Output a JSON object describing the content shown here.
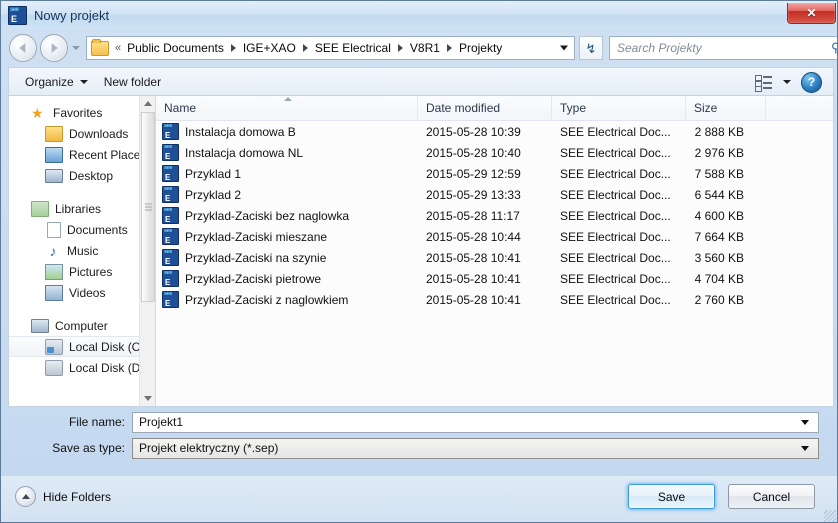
{
  "window": {
    "title": "Nowy projekt",
    "app_icon": "see-electrical-icon",
    "close_label": "✕"
  },
  "nav": {
    "back_icon": "back-arrow-icon",
    "forward_icon": "forward-arrow-icon",
    "recent_caret_icon": "chevron-down-icon",
    "breadcrumb_overflow": "«",
    "breadcrumbs": [
      "Public Documents",
      "IGE+XAO",
      "SEE Electrical",
      "V8R1",
      "Projekty"
    ],
    "refresh_icon": "refresh-icon",
    "refresh_glyph": "↯"
  },
  "search": {
    "placeholder": "Search Projekty",
    "icon": "search-icon",
    "glyph": "⚲"
  },
  "toolbar": {
    "organize_label": "Organize",
    "new_folder_label": "New folder",
    "view_icon": "view-options-icon",
    "help_label": "?"
  },
  "sidebar": {
    "groups": [
      {
        "header": {
          "label": "Favorites",
          "icon": "star-icon"
        },
        "items": [
          {
            "label": "Downloads",
            "icon": "downloads-folder-icon"
          },
          {
            "label": "Recent Places",
            "icon": "recent-places-icon"
          },
          {
            "label": "Desktop",
            "icon": "desktop-icon"
          }
        ]
      },
      {
        "header": {
          "label": "Libraries",
          "icon": "libraries-icon"
        },
        "items": [
          {
            "label": "Documents",
            "icon": "documents-icon"
          },
          {
            "label": "Music",
            "icon": "music-icon"
          },
          {
            "label": "Pictures",
            "icon": "pictures-icon"
          },
          {
            "label": "Videos",
            "icon": "videos-icon"
          }
        ]
      },
      {
        "header": {
          "label": "Computer",
          "icon": "computer-icon"
        },
        "items": [
          {
            "label": "Local Disk (C:)",
            "icon": "system-disk-icon",
            "selected": true
          },
          {
            "label": "Local Disk (D:)",
            "icon": "disk-icon"
          }
        ]
      }
    ]
  },
  "filelist": {
    "columns": [
      {
        "key": "name",
        "label": "Name",
        "sorted": "asc"
      },
      {
        "key": "date",
        "label": "Date modified"
      },
      {
        "key": "type",
        "label": "Type"
      },
      {
        "key": "size",
        "label": "Size"
      }
    ],
    "rows": [
      {
        "name": "Instalacja domowa B",
        "date": "2015-05-28 10:39",
        "type": "SEE Electrical Doc...",
        "size": "2 888 KB"
      },
      {
        "name": "Instalacja domowa NL",
        "date": "2015-05-28 10:40",
        "type": "SEE Electrical Doc...",
        "size": "2 976 KB"
      },
      {
        "name": "Przyklad 1",
        "date": "2015-05-29 12:59",
        "type": "SEE Electrical Doc...",
        "size": "7 588 KB"
      },
      {
        "name": "Przyklad 2",
        "date": "2015-05-29 13:33",
        "type": "SEE Electrical Doc...",
        "size": "6 544 KB"
      },
      {
        "name": "Przyklad-Zaciski bez naglowka",
        "date": "2015-05-28 11:17",
        "type": "SEE Electrical Doc...",
        "size": "4 600 KB"
      },
      {
        "name": "Przyklad-Zaciski mieszane",
        "date": "2015-05-28 10:44",
        "type": "SEE Electrical Doc...",
        "size": "7 664 KB"
      },
      {
        "name": "Przyklad-Zaciski na szynie",
        "date": "2015-05-28 10:41",
        "type": "SEE Electrical Doc...",
        "size": "3 560 KB"
      },
      {
        "name": "Przyklad-Zaciski pietrowe",
        "date": "2015-05-28 10:41",
        "type": "SEE Electrical Doc...",
        "size": "4 704 KB"
      },
      {
        "name": "Przyklad-Zaciski z naglowkiem",
        "date": "2015-05-28 10:41",
        "type": "SEE Electrical Doc...",
        "size": "2 760 KB"
      }
    ]
  },
  "form": {
    "filename_label": "File name:",
    "filename_value": "Projekt1",
    "savetype_label": "Save as type:",
    "savetype_value": "Projekt elektryczny (*.sep)"
  },
  "footer": {
    "hide_folders_label": "Hide Folders",
    "save_label": "Save",
    "cancel_label": "Cancel"
  },
  "colors": {
    "accent": "#3c9ad4",
    "titlebar": "#cfe2f5",
    "close_button": "#c42e23",
    "help_button": "#2e7fc0"
  }
}
